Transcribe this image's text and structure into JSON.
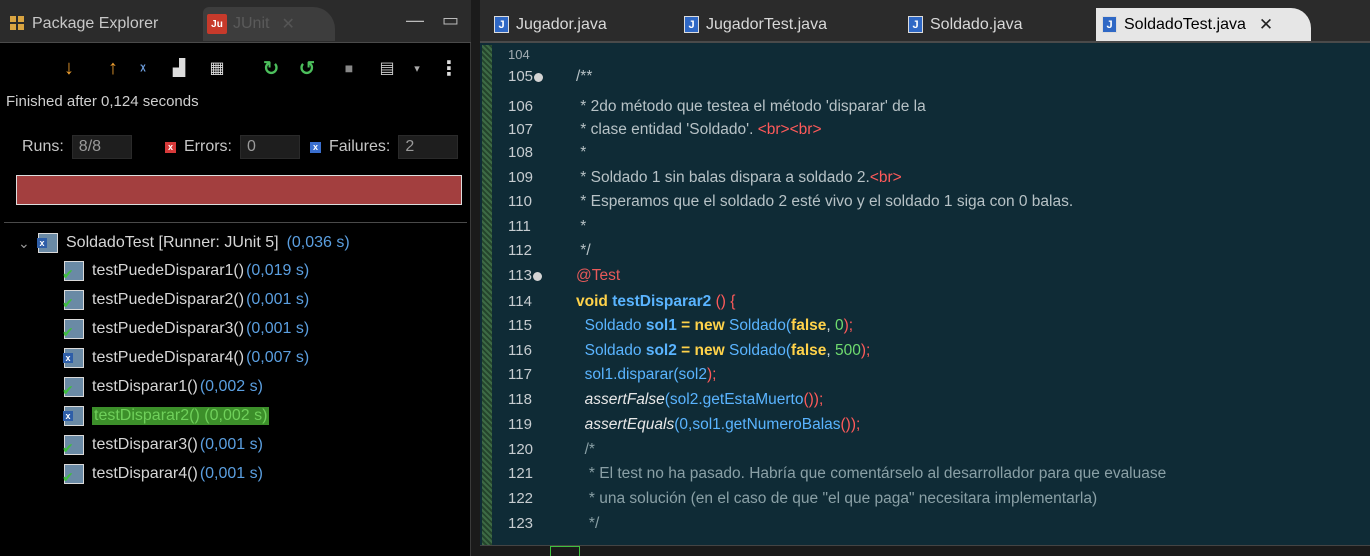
{
  "left_panel": {
    "tabs": {
      "package_explorer": "Package Explorer",
      "junit": "JUnit"
    },
    "finished_text": "Finished after 0,124 seconds",
    "counters": {
      "runs_label": "Runs:",
      "runs_value": "8/8",
      "errors_label": "Errors:",
      "errors_value": "0",
      "failures_label": "Failures:",
      "failures_value": "2"
    },
    "progress_color": "#a33f3f",
    "tree": {
      "root": {
        "label": "SoldadoTest [Runner: JUnit 5]",
        "time": "(0,036 s)"
      },
      "items": [
        {
          "label": "testPuedeDisparar1()",
          "time": "(0,019 s)",
          "status": "pass"
        },
        {
          "label": "testPuedeDisparar2()",
          "time": "(0,001 s)",
          "status": "pass"
        },
        {
          "label": "testPuedeDisparar3()",
          "time": "(0,001 s)",
          "status": "pass"
        },
        {
          "label": "testPuedeDisparar4()",
          "time": "(0,007 s)",
          "status": "fail"
        },
        {
          "label": "testDisparar1()",
          "time": "(0,002 s)",
          "status": "pass"
        },
        {
          "label": "testDisparar2()",
          "time": "(0,002 s)",
          "status": "fail",
          "selected": true
        },
        {
          "label": "testDisparar3()",
          "time": "(0,001 s)",
          "status": "pass"
        },
        {
          "label": "testDisparar4()",
          "time": "(0,001 s)",
          "status": "pass"
        }
      ]
    }
  },
  "editor": {
    "tabs": [
      "Jugador.java",
      "JugadorTest.java",
      "Soldado.java",
      "SoldadoTest.java"
    ],
    "active_tab": "SoldadoTest.java",
    "line_numbers": [
      "104",
      "105",
      "106",
      "107",
      "108",
      "109",
      "110",
      "111",
      "112",
      "113",
      "114",
      "115",
      "116",
      "117",
      "118",
      "119",
      "120",
      "121",
      "122",
      "123"
    ],
    "lines": {
      "l105": "/**",
      "l106": " * 2do método que testea el método 'disparar' de la",
      "l107a": " * clase entidad 'Soldado'. ",
      "l107b": "<br><br>",
      "l108": " *",
      "l109a": " * Soldado 1 sin balas dispara a soldado 2.",
      "l109b": "<br>",
      "l110": " * Esperamos que el soldado 2 esté vivo y el soldado 1 siga con 0 balas.",
      "l111": " *",
      "l112": " */",
      "l113": "@Test",
      "l114_kw": "void",
      "l114_name": "testDisparar2",
      "l114_rest": " () {",
      "l115_type": "Soldado",
      "l115_var": "sol1",
      "l115_eq": " = ",
      "l115_new": "new",
      "l115_ctor": " Soldado(",
      "l115_bool": "false",
      "l115_comma": ", ",
      "l115_num": "0",
      "l115_end": ");",
      "l116_type": "Soldado",
      "l116_var": "sol2",
      "l116_eq": " = ",
      "l116_new": "new",
      "l116_ctor": " Soldado(",
      "l116_bool": "false",
      "l116_comma": ", ",
      "l116_num": "500",
      "l116_end": ");",
      "l117_obj": "sol1",
      "l117_call": ".disparar(",
      "l117_arg": "sol2",
      "l117_end": ");",
      "l118_fn": "assertFalse",
      "l118_arg": "(sol2.getEstaMuerto",
      "l118_end": "());",
      "l119_fn": "assertEquals",
      "l119_arg": "(0,sol1.getNumeroBalas",
      "l119_end": "());",
      "l120": "/*",
      "l121": " * El test no ha pasado. Habría que comentárselo al desarrollador para que evaluase",
      "l122": " * una solución (en el caso de que \"el que paga\" necesitara implementarla)",
      "l123": " */"
    }
  }
}
